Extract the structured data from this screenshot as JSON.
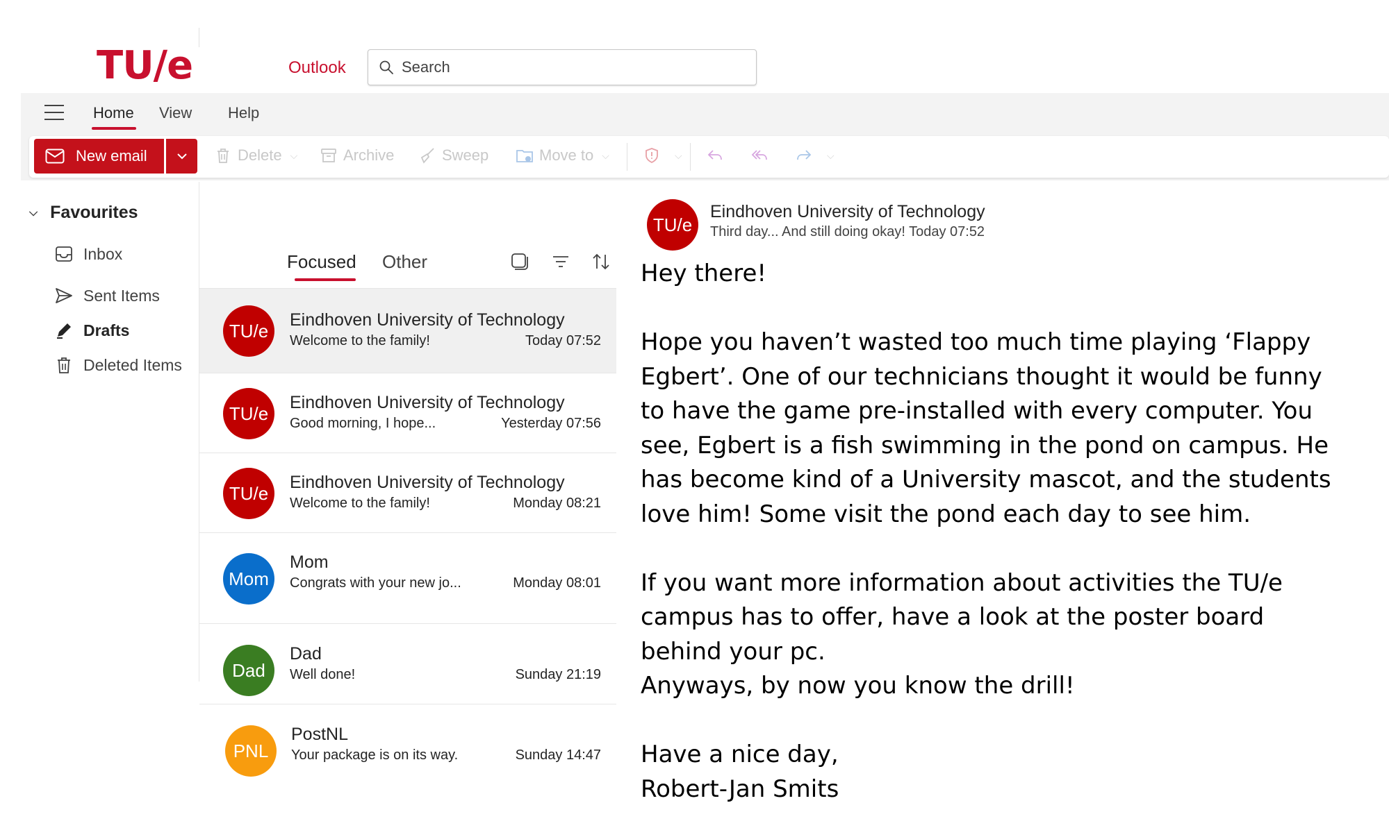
{
  "brand": {
    "logo": "TU/e",
    "app_name": "Outlook",
    "accent": "#c8102e"
  },
  "search": {
    "placeholder": "Search"
  },
  "ribbon": {
    "tabs": [
      {
        "label": "Home",
        "active": true
      },
      {
        "label": "View"
      },
      {
        "label": "Help"
      }
    ],
    "new_email_label": "New email",
    "actions": {
      "delete": "Delete",
      "archive": "Archive",
      "sweep": "Sweep",
      "move_to": "Move to"
    }
  },
  "nav": {
    "favourites_label": "Favourites",
    "items": [
      {
        "label": "Inbox",
        "icon": "inbox-icon"
      },
      {
        "label": "Sent Items",
        "icon": "send-icon"
      },
      {
        "label": "Drafts",
        "icon": "pencil-icon",
        "bold": true
      },
      {
        "label": "Deleted Items",
        "icon": "trash-icon"
      }
    ]
  },
  "list": {
    "tabs": {
      "focused": "Focused",
      "other": "Other"
    },
    "messages": [
      {
        "initials": "TU/e",
        "sender": "Eindhoven University of Technology",
        "preview": "Welcome to the family!",
        "time": "Today 07:52",
        "color": "#c00000",
        "selected": true
      },
      {
        "initials": "TU/e",
        "sender": "Eindhoven University of Technology",
        "preview": "Good morning, I hope...",
        "time": "Yesterday 07:56",
        "color": "#c00000"
      },
      {
        "initials": "TU/e",
        "sender": "Eindhoven University of Technology",
        "preview": "Welcome to the family!",
        "time": "Monday 08:21",
        "color": "#c00000"
      },
      {
        "initials": "Mom",
        "sender": "Mom",
        "preview": "Congrats with your new jo...",
        "time": "Monday 08:01",
        "color": "#0a6ecb"
      },
      {
        "initials": "Dad",
        "sender": "Dad",
        "preview": "Well done!",
        "time": "Sunday 21:19",
        "color": "#3a7d22"
      },
      {
        "initials": "PNL",
        "sender": "PostNL",
        "preview": "Your package is on its way.",
        "time": "Sunday 14:47",
        "color": "#f89c0e"
      }
    ]
  },
  "reading": {
    "initials": "TU/e",
    "sender": "Eindhoven University of Technology",
    "subject_and_time": "Third day... And still doing okay!  Today 07:52",
    "body": {
      "greeting": "Hey there!",
      "p1_l1": "Hope you haven’t wasted too much time playing ‘Flappy",
      "p1_l2": "Egbert’. One of our technicians thought it would be funny",
      "p1_l3": "to have the game pre-installed with every computer. You",
      "p1_l4": "see, Egbert is a fish swimming in the pond on campus. He",
      "p1_l5": "has become kind of a University mascot, and the students",
      "p1_l6": "love him! Some visit the pond each day to see him.",
      "p2_l1": "If you want more information about activities the TU/e",
      "p2_l2": "campus has to offer, have a look at the poster board",
      "p2_l3": "behind your pc.",
      "p2_l4": "Anyways, by now you know the drill!",
      "closing": "Have a nice day,",
      "signature": "Robert-Jan Smits"
    }
  }
}
